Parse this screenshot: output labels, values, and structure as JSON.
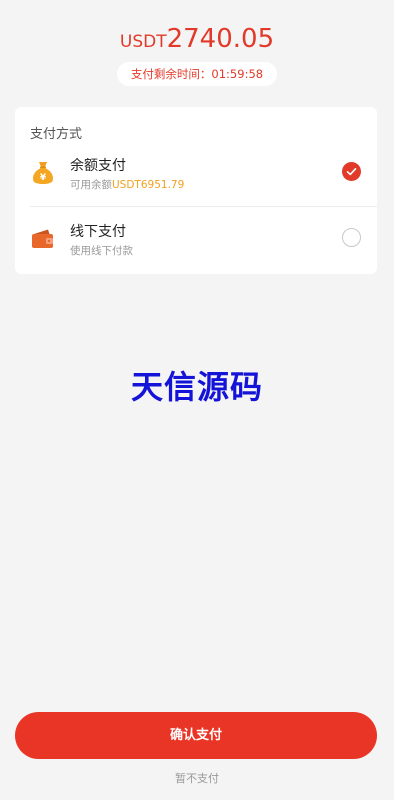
{
  "payment": {
    "currency": "USDT",
    "amount": "2740.05",
    "timer_label": "支付剩余时间：",
    "timer_value": "01:59:58"
  },
  "methods": {
    "title": "支付方式",
    "items": [
      {
        "label": "余额支付",
        "sub_prefix": "可用余额",
        "sub_value": "USDT6951.79",
        "icon": "money-bag-icon",
        "selected": true
      },
      {
        "label": "线下支付",
        "sub_prefix": "使用线下付款",
        "icon": "wallet-icon",
        "selected": false
      }
    ]
  },
  "watermark": "天信源码",
  "actions": {
    "confirm_label": "确认支付",
    "skip_label": "暂不支付"
  },
  "colors": {
    "accent": "#e23a2a",
    "button": "#e93526",
    "balance": "#f0a020",
    "watermark": "#1414d8",
    "background": "#f4f4f4"
  }
}
